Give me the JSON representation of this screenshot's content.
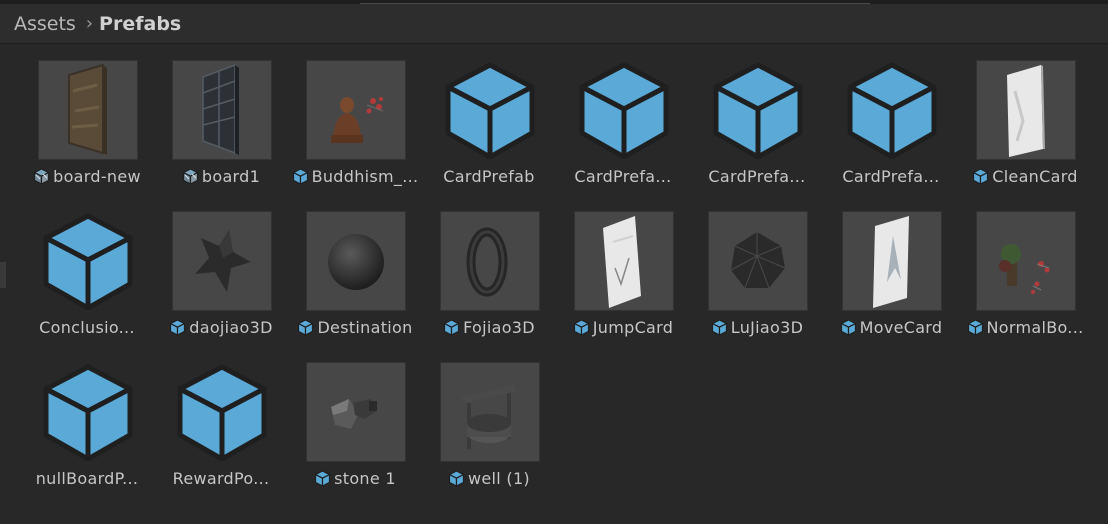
{
  "breadcrumb": {
    "root": "Assets",
    "current": "Prefabs"
  },
  "colors": {
    "cube_blue": "#5aa9d6",
    "cube_outline": "#1f1f1f",
    "thumb_bg": "#474747",
    "label": "#c6c6c6"
  },
  "assets": [
    {
      "name": "board-new",
      "thumbnail": "textured-panel-brown",
      "icon": "prefab-variant-icon"
    },
    {
      "name": "board1",
      "thumbnail": "tiled-panel-dark",
      "icon": "prefab-variant-icon"
    },
    {
      "name": "Buddhism_...",
      "thumbnail": "buddha-statue",
      "icon": "prefab-small-icon"
    },
    {
      "name": "CardPrefab",
      "thumbnail": "blue-cube",
      "icon": "none"
    },
    {
      "name": "CardPrefa...",
      "thumbnail": "blue-cube",
      "icon": "none"
    },
    {
      "name": "CardPrefa...",
      "thumbnail": "blue-cube",
      "icon": "none"
    },
    {
      "name": "CardPrefa...",
      "thumbnail": "blue-cube",
      "icon": "none"
    },
    {
      "name": "CleanCard",
      "thumbnail": "white-card",
      "icon": "prefab-icon"
    },
    {
      "name": "Conclusio...",
      "thumbnail": "blue-cube",
      "icon": "none"
    },
    {
      "name": "daojiao3D",
      "thumbnail": "star-shape",
      "icon": "prefab-icon"
    },
    {
      "name": "Destination",
      "thumbnail": "dark-sphere",
      "icon": "prefab-icon"
    },
    {
      "name": "Fojiao3D",
      "thumbnail": "ring-shape",
      "icon": "prefab-icon"
    },
    {
      "name": "JumpCard",
      "thumbnail": "white-card-arrow",
      "icon": "prefab-icon"
    },
    {
      "name": "LuJiao3D",
      "thumbnail": "low-poly-sphere",
      "icon": "prefab-icon"
    },
    {
      "name": "MoveCard",
      "thumbnail": "white-card-a",
      "icon": "prefab-icon"
    },
    {
      "name": "NormalBo...",
      "thumbnail": "tree-model",
      "icon": "prefab-icon"
    },
    {
      "name": "nullBoardP...",
      "thumbnail": "blue-cube",
      "icon": "none"
    },
    {
      "name": "RewardPo...",
      "thumbnail": "blue-cube",
      "icon": "none"
    },
    {
      "name": "stone 1",
      "thumbnail": "stone-model",
      "icon": "prefab-icon"
    },
    {
      "name": "well (1)",
      "thumbnail": "well-model",
      "icon": "prefab-icon"
    }
  ]
}
